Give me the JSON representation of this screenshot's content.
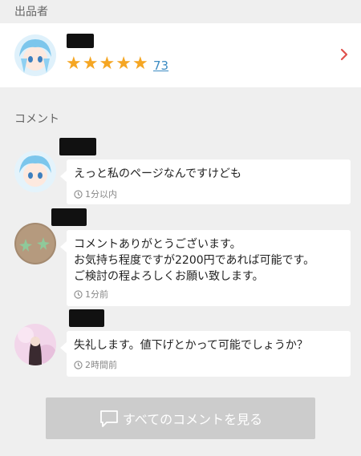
{
  "seller_section": {
    "label": "出品者",
    "rating_count": "73",
    "rating": 5,
    "star_color": "#f5a623"
  },
  "comments_section": {
    "label": "コメント",
    "comments": [
      {
        "text": "えっと私のページなんですけども",
        "time": "1分以内"
      },
      {
        "text": "コメントありがとうございます。\nお気持ち程度ですが2200円であれば可能です。\nご検討の程よろしくお願い致します。",
        "time": "1分前"
      },
      {
        "text": "失礼します。値下げとかって可能でしょうか？",
        "time": "2時間前"
      }
    ]
  },
  "view_all_button": {
    "label": "すべてのコメントを見る"
  },
  "colors": {
    "link": "#3b8bc2",
    "chevron": "#e0524d",
    "button_bg": "#cccccc"
  }
}
